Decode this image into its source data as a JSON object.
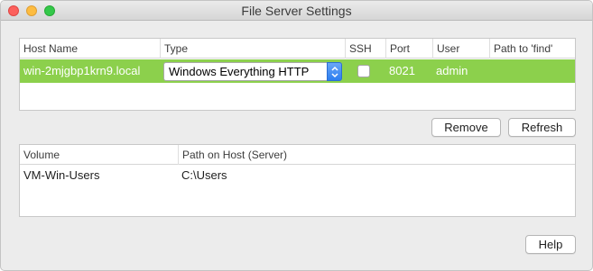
{
  "window": {
    "title": "File Server Settings"
  },
  "host_table": {
    "columns": [
      "Host Name",
      "Type",
      "SSH",
      "Port",
      "User",
      "Path to 'find'"
    ],
    "rows": [
      {
        "host_name": "win-2mjgbp1krn9.local",
        "type": "Windows Everything HTTP",
        "ssh": false,
        "port": "8021",
        "user": "admin",
        "path_to_find": ""
      }
    ],
    "selected_row_color": "#8cd04c"
  },
  "buttons": {
    "remove": "Remove",
    "refresh": "Refresh",
    "help": "Help"
  },
  "volume_table": {
    "columns": [
      "Volume",
      "Path on Host (Server)"
    ],
    "rows": [
      {
        "volume": "VM-Win-Users",
        "path": "C:\\Users"
      }
    ]
  }
}
